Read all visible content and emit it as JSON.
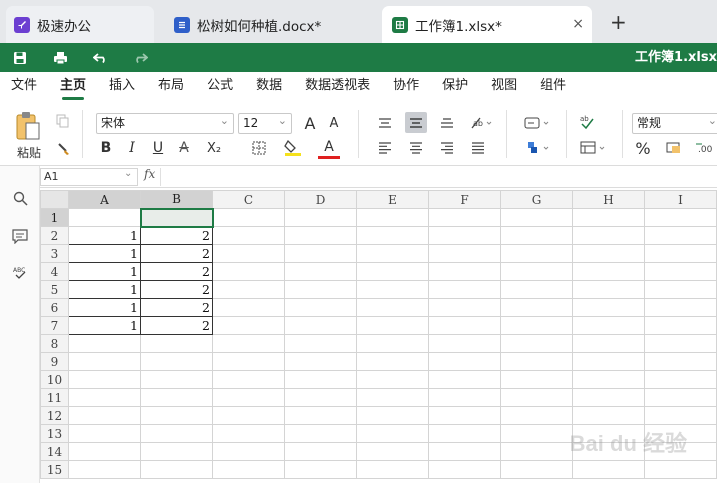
{
  "tabs": [
    {
      "label": "极速办公",
      "icon": "rocket-icon",
      "color": "#6c3fd1"
    },
    {
      "label": "松树如何种植.docx*",
      "icon": "doc-icon",
      "color": "#2f5fc9"
    },
    {
      "label": "工作簿1.xlsx*",
      "icon": "sheet-icon",
      "color": "#1e7b45"
    }
  ],
  "new_tab": "+",
  "close_glyph": "×",
  "doc_title": "工作簿1.xlsx",
  "menu": [
    "文件",
    "主页",
    "插入",
    "布局",
    "公式",
    "数据",
    "数据透视表",
    "协作",
    "保护",
    "视图",
    "组件"
  ],
  "ribbon": {
    "paste_label": "粘贴",
    "font_name": "宋体",
    "font_size": "12",
    "number_format": "常规",
    "bold": "B",
    "italic": "I",
    "underline": "U",
    "strike": "A",
    "subscript": "X₂",
    "font_color": "A",
    "grow": "A",
    "shrink": "A",
    "percent": "%"
  },
  "namebox": "A1",
  "fx": "fx",
  "columns": [
    "A",
    "B",
    "C",
    "D",
    "E",
    "F",
    "G",
    "H",
    "I"
  ],
  "rows": [
    [
      "",
      ""
    ],
    [
      "1",
      "2"
    ],
    [
      "1",
      "2"
    ],
    [
      "1",
      "2"
    ],
    [
      "1",
      "2"
    ],
    [
      "1",
      "2"
    ],
    [
      "1",
      "2"
    ],
    [
      "",
      ""
    ],
    [
      "",
      ""
    ],
    [
      "",
      ""
    ],
    [
      "",
      ""
    ],
    [
      "",
      ""
    ],
    [
      "",
      ""
    ],
    [
      "",
      ""
    ],
    [
      "",
      ""
    ]
  ],
  "watermark": "Bai du 经验",
  "colors": {
    "accent": "#1e7b45",
    "tab_bg": "#e6e8eb"
  }
}
